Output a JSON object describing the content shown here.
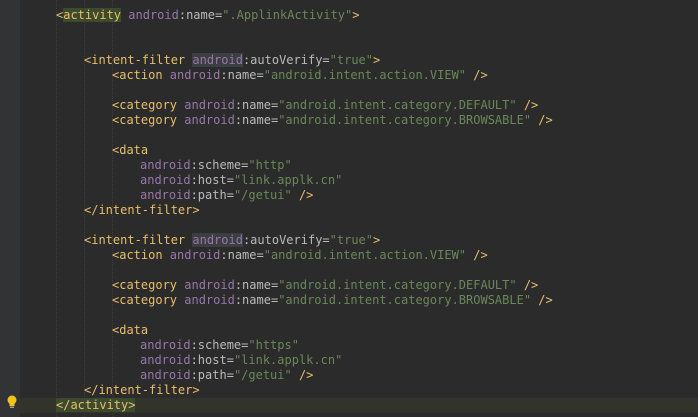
{
  "editor": {
    "lines": [
      {
        "parts": [
          {
            "t": "<",
            "c": "tag"
          },
          {
            "t": "activity",
            "c": "tag"
          },
          {
            "t": " ",
            "c": ""
          },
          {
            "t": "android",
            "c": "attr-ns"
          },
          {
            "t": ":name=",
            "c": "attr"
          },
          {
            "t": "\".ApplinkActivity\"",
            "c": "val"
          },
          {
            "t": ">",
            "c": "tag"
          }
        ]
      },
      {
        "parts": [
          {
            "t": "<intent-filter ",
            "c": "tag"
          },
          {
            "t": "android",
            "c": "attr-ns"
          },
          {
            "t": ":autoVerify=",
            "c": "attr"
          },
          {
            "t": "\"true\"",
            "c": "val"
          },
          {
            "t": ">",
            "c": "tag"
          }
        ]
      },
      {
        "parts": [
          {
            "t": "<action ",
            "c": "tag"
          },
          {
            "t": "android",
            "c": "attr-ns"
          },
          {
            "t": ":name=",
            "c": "attr"
          },
          {
            "t": "\"android.intent.action.VIEW\"",
            "c": "val"
          },
          {
            "t": " />",
            "c": "tag"
          }
        ]
      },
      {
        "parts": [
          {
            "t": "<category ",
            "c": "tag"
          },
          {
            "t": "android",
            "c": "attr-ns"
          },
          {
            "t": ":name=",
            "c": "attr"
          },
          {
            "t": "\"android.intent.category.DEFAULT\"",
            "c": "val"
          },
          {
            "t": " />",
            "c": "tag"
          }
        ]
      },
      {
        "parts": [
          {
            "t": "<category ",
            "c": "tag"
          },
          {
            "t": "android",
            "c": "attr-ns"
          },
          {
            "t": ":name=",
            "c": "attr"
          },
          {
            "t": "\"android.intent.category.BROWSABLE\"",
            "c": "val"
          },
          {
            "t": " />",
            "c": "tag"
          }
        ]
      },
      {
        "parts": [
          {
            "t": "<data",
            "c": "tag"
          }
        ]
      },
      {
        "parts": [
          {
            "t": "android",
            "c": "attr-ns"
          },
          {
            "t": ":scheme=",
            "c": "attr"
          },
          {
            "t": "\"http\"",
            "c": "val"
          }
        ]
      },
      {
        "parts": [
          {
            "t": "android",
            "c": "attr-ns"
          },
          {
            "t": ":host=",
            "c": "attr"
          },
          {
            "t": "\"link.applk.cn\"",
            "c": "val"
          }
        ]
      },
      {
        "parts": [
          {
            "t": "android",
            "c": "attr-ns"
          },
          {
            "t": ":path=",
            "c": "attr"
          },
          {
            "t": "\"/getui\"",
            "c": "val"
          },
          {
            "t": " />",
            "c": "tag"
          }
        ]
      },
      {
        "parts": [
          {
            "t": "</intent-filter>",
            "c": "tag"
          }
        ]
      },
      {
        "parts": [
          {
            "t": "<intent-filter ",
            "c": "tag"
          },
          {
            "t": "android",
            "c": "attr-ns"
          },
          {
            "t": ":autoVerify=",
            "c": "attr"
          },
          {
            "t": "\"true\"",
            "c": "val"
          },
          {
            "t": ">",
            "c": "tag"
          }
        ]
      },
      {
        "parts": [
          {
            "t": "<action ",
            "c": "tag"
          },
          {
            "t": "android",
            "c": "attr-ns"
          },
          {
            "t": ":name=",
            "c": "attr"
          },
          {
            "t": "\"android.intent.action.VIEW\"",
            "c": "val"
          },
          {
            "t": " />",
            "c": "tag"
          }
        ]
      },
      {
        "parts": [
          {
            "t": "<category ",
            "c": "tag"
          },
          {
            "t": "android",
            "c": "attr-ns"
          },
          {
            "t": ":name=",
            "c": "attr"
          },
          {
            "t": "\"android.intent.category.DEFAULT\"",
            "c": "val"
          },
          {
            "t": " />",
            "c": "tag"
          }
        ]
      },
      {
        "parts": [
          {
            "t": "<category ",
            "c": "tag"
          },
          {
            "t": "android",
            "c": "attr-ns"
          },
          {
            "t": ":name=",
            "c": "attr"
          },
          {
            "t": "\"android.intent.category.BROWSABLE\"",
            "c": "val"
          },
          {
            "t": " />",
            "c": "tag"
          }
        ]
      },
      {
        "parts": [
          {
            "t": "<data",
            "c": "tag"
          }
        ]
      },
      {
        "parts": [
          {
            "t": "android",
            "c": "attr-ns"
          },
          {
            "t": ":scheme=",
            "c": "attr"
          },
          {
            "t": "\"https\"",
            "c": "val"
          }
        ]
      },
      {
        "parts": [
          {
            "t": "android",
            "c": "attr-ns"
          },
          {
            "t": ":host=",
            "c": "attr"
          },
          {
            "t": "\"link.applk.cn\"",
            "c": "val"
          }
        ]
      },
      {
        "parts": [
          {
            "t": "android",
            "c": "attr-ns"
          },
          {
            "t": ":path=",
            "c": "attr"
          },
          {
            "t": "\"/getui\"",
            "c": "val"
          },
          {
            "t": " />",
            "c": "tag"
          }
        ]
      },
      {
        "parts": [
          {
            "t": "</intent-filter>",
            "c": "tag"
          }
        ]
      },
      {
        "parts": [
          {
            "t": "</activity>",
            "c": "tag"
          }
        ]
      }
    ]
  },
  "colors": {
    "background": "#2b2b2b",
    "tag": "#e8bf6a",
    "namespace": "#9876aa",
    "attribute": "#bababa",
    "string": "#6a8759"
  },
  "icons": {
    "intention": "lightbulb-icon"
  }
}
